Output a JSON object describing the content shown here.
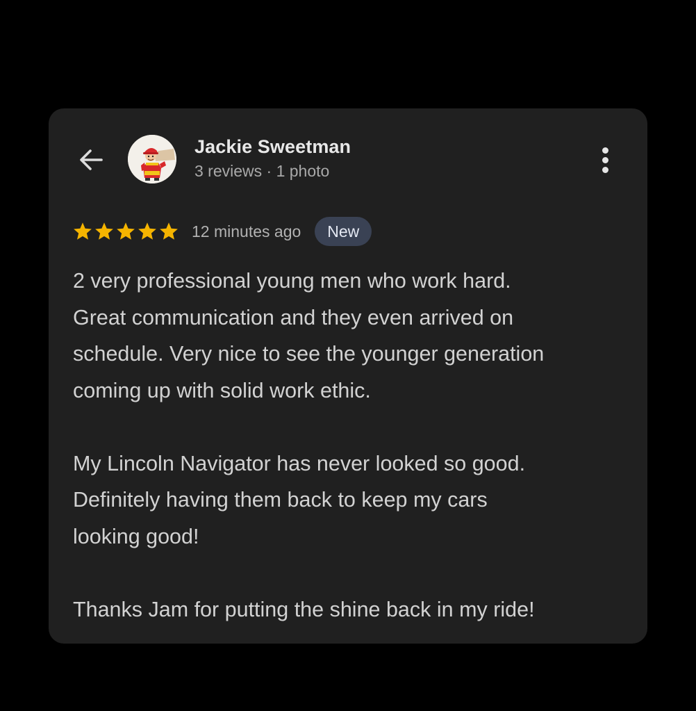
{
  "review": {
    "author": {
      "name": "Jackie Sweetman",
      "meta": "3 reviews · 1 photo",
      "avatar_icon": "cartoon-mechanic-avatar"
    },
    "rating": {
      "stars": 5,
      "max": 5,
      "star_color": "#f5b400"
    },
    "time_ago": "12 minutes ago",
    "badge": "New",
    "paragraphs": [
      "2 very professional young men who work hard.\nGreat communication and they even arrived on\nschedule. Very nice to see the younger generation\ncoming up with solid work ethic.",
      "My Lincoln Navigator has never looked so good.\nDefinitely having them back to keep my cars\nlooking good!",
      "Thanks Jam for putting the shine back in my ride!"
    ]
  },
  "icons": {
    "back": "arrow-left-icon",
    "more": "more-vert-icon"
  },
  "colors": {
    "page_background": "#000000",
    "card_background": "#202020",
    "badge_background": "#3a4254"
  }
}
